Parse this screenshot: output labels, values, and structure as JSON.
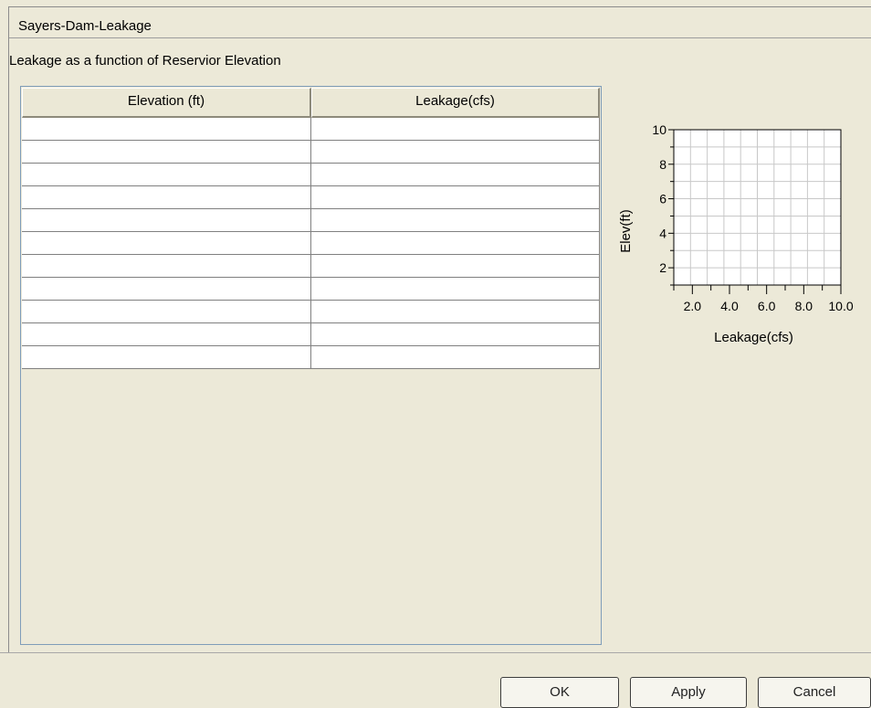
{
  "panel": {
    "title": "Sayers-Dam-Leakage",
    "section_label": "Leakage as a function of Reservior Elevation"
  },
  "table": {
    "columns": [
      "Elevation (ft)",
      "Leakage(cfs)"
    ],
    "rows": [
      [
        "",
        ""
      ],
      [
        "",
        ""
      ],
      [
        "",
        ""
      ],
      [
        "",
        ""
      ],
      [
        "",
        ""
      ],
      [
        "",
        ""
      ],
      [
        "",
        ""
      ],
      [
        "",
        ""
      ],
      [
        "",
        ""
      ],
      [
        "",
        ""
      ],
      [
        "",
        ""
      ]
    ]
  },
  "chart_data": {
    "type": "line",
    "title": "",
    "xlabel": "Leakage(cfs)",
    "ylabel": "Elev(ft)",
    "xlim": [
      1,
      10
    ],
    "ylim": [
      1,
      10
    ],
    "x_ticks": [
      "2.0",
      "4.0",
      "6.0",
      "8.0",
      "10.0"
    ],
    "y_ticks": [
      "10",
      "8",
      "6",
      "4",
      "2"
    ],
    "grid": true,
    "series": []
  },
  "buttons": {
    "ok": "OK",
    "apply": "Apply",
    "cancel": "Cancel"
  }
}
